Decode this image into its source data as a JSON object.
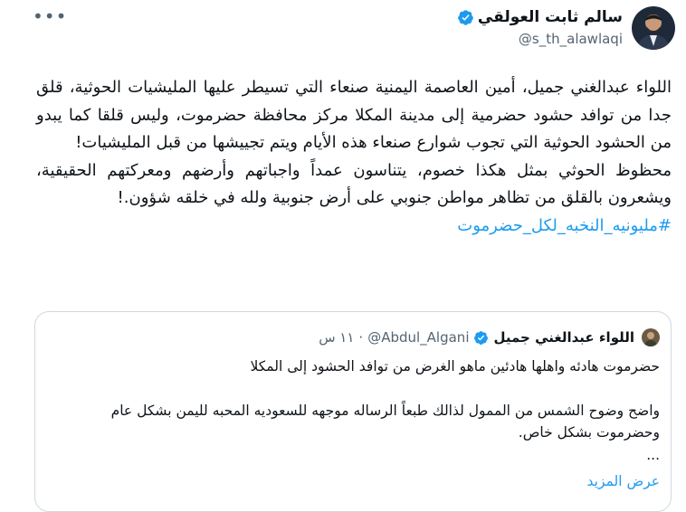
{
  "tweet": {
    "author_name": "سالم ثابت العولقي",
    "author_handle": "@s_th_alawlaqi",
    "more_icon": "more-horizontal-icon",
    "verified_color": "#1d9bf0",
    "paragraphs": [
      "اللواء عبدالغني جميل، أمين العاصمة اليمنية صنعاء التي تسيطر عليها المليشيات الحوثية، قلق جدا من توافد حشود حضرمية إلى مدينة المكلا مركز محافظة حضرموت، وليس قلقا كما يبدو من الحشود الحوثية التي تجوب شوارع صنعاء هذه الأيام ويتم تجييشها من قبل المليشيات!",
      "محظوظ الحوثي بمثل هكذا خصوم، يتناسون عمداً واجباتهم وأرضهم ومعركتهم الحقيقية، ويشعرون بالقلق من تظاهر مواطن جنوبي على أرض جنوبية ولله في خلقه شؤون.!"
    ],
    "hashtag": "#مليونيه_النخبه_لكل_حضرموت",
    "hashtag_color": "#1d9bf0"
  },
  "quote": {
    "author_name": "اللواء عبدالغني جميل",
    "author_handle": "@Abdul_Algani",
    "separator": "·",
    "time": "١١ س",
    "paragraphs": [
      "حضرموت هادئه واهلها هادئين ماهو الغرض من توافد الحشود إلى المكلا",
      "واضح وضوح الشمس من الممول لذالك طبعاً الرساله موجهه للسعوديه المحبه لليمن بشكل عام وحضرموت بشكل خاص."
    ],
    "ellipsis": "...",
    "show_more": "عرض المزيد"
  }
}
